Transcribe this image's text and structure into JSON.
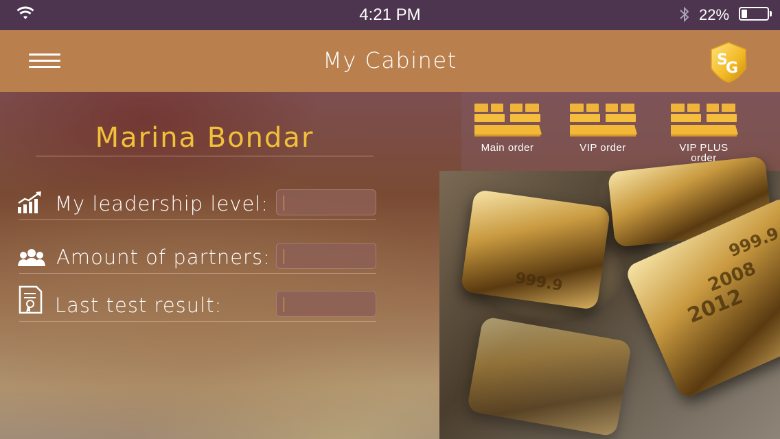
{
  "status_bar": {
    "time": "4:21 PM",
    "battery_percent": "22%",
    "battery_level": 0.22,
    "icons": [
      "wifi-icon",
      "bluetooth-icon",
      "battery-icon"
    ]
  },
  "nav": {
    "title": "My Cabinet",
    "menu_icon": "hamburger-menu-icon",
    "logo_text": "SG"
  },
  "profile": {
    "name": "Marina Bondar"
  },
  "orders": [
    {
      "label": "Main order",
      "icon": "gold-bars-icon"
    },
    {
      "label": "VIP order",
      "icon": "gold-bars-icon"
    },
    {
      "label": "VIP PLUS order",
      "icon": "gold-bars-icon"
    }
  ],
  "stats": [
    {
      "label": "My leadership level:",
      "value": "",
      "icon": "growth-chart-icon"
    },
    {
      "label": "Amount of partners:",
      "value": "",
      "icon": "people-icon"
    },
    {
      "label": "Last test result:",
      "value": "",
      "icon": "certificate-icon"
    }
  ],
  "colors": {
    "status_bar": "#4d3550",
    "nav_bar": "#b9804e",
    "name_accent": "#f2c13a",
    "gold": "#f0b43a"
  },
  "decor": {
    "bar_stamps": [
      "999.9",
      "2008",
      "2012",
      "999.9"
    ]
  }
}
